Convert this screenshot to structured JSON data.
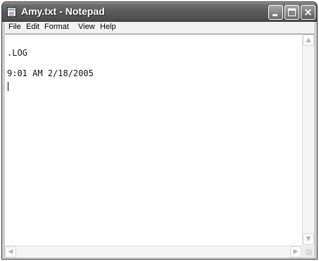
{
  "window": {
    "title": "Amy.txt - Notepad",
    "icon": "notepad-icon"
  },
  "title_buttons": {
    "minimize_icon": "minimize-icon",
    "maximize_icon": "maximize-icon",
    "close_icon": "close-icon",
    "close_glyph": "×"
  },
  "menu": {
    "items": [
      "File",
      "Edit",
      "Format",
      "View",
      "Help"
    ]
  },
  "document": {
    "lines": [
      ".LOG",
      "9:01 AM 2/18/2005"
    ]
  },
  "scrollbars": {
    "up_glyph": "▲",
    "down_glyph": "▼",
    "left_glyph": "◀",
    "right_glyph": "▶"
  }
}
